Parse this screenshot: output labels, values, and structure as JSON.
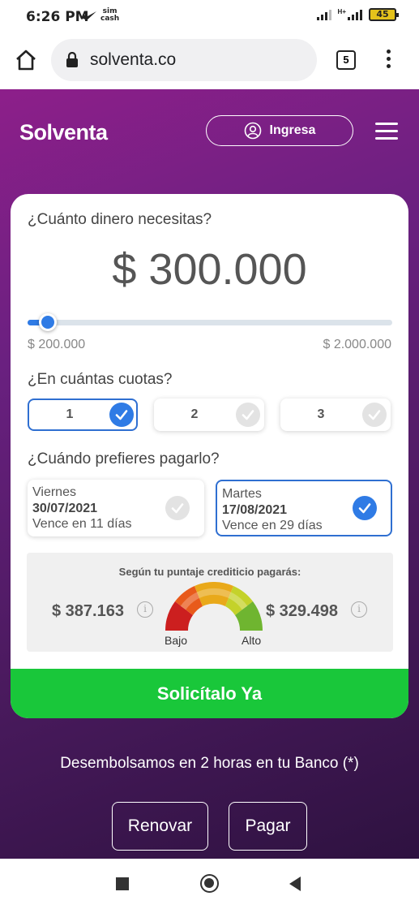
{
  "status": {
    "time": "6:26 PM",
    "sim_line1": "sim",
    "sim_line2": "cash",
    "network": "H+",
    "battery": "45"
  },
  "browser": {
    "url": "solventa.co",
    "tab_count": "5"
  },
  "header": {
    "logo": "Solventa",
    "login_label": "Ingresa"
  },
  "loan": {
    "question_amount": "¿Cuánto dinero necesitas?",
    "amount": "$ 300.000",
    "slider_level": 0.0556,
    "min_label": "$ 200.000",
    "max_label": "$ 2.000.000",
    "question_installments": "¿En cuántas cuotas?",
    "installments": [
      {
        "label": "1",
        "selected": true
      },
      {
        "label": "2",
        "selected": false
      },
      {
        "label": "3",
        "selected": false
      }
    ],
    "question_date": "¿Cuándo prefieres pagarlo?",
    "dates": [
      {
        "day": "Viernes",
        "date": "30/07/2021",
        "due": "Vence en 11 días",
        "selected": false
      },
      {
        "day": "Martes",
        "date": "17/08/2021",
        "due": "Vence en 29 días",
        "selected": true
      }
    ],
    "score_label": "Según tu puntaje crediticio pagarás:",
    "pay_low": "$ 387.163",
    "pay_high": "$ 329.498",
    "gauge_low": "Bajo",
    "gauge_high": "Alto",
    "info_icon": "i",
    "cta": "Solicítalo Ya"
  },
  "footer": {
    "disbursement": "Desembolsamos en 2 horas en tu Banco (*)",
    "renew_label": "Renovar",
    "pay_label": "Pagar"
  },
  "colors": {
    "accent": "#2f7be5",
    "cta": "#19c73a",
    "brand_purple": "#6a2080"
  },
  "icons": [
    "home-icon",
    "lock-icon",
    "user-icon",
    "menu-icon",
    "check-icon",
    "info-icon",
    "gauge-icon"
  ]
}
